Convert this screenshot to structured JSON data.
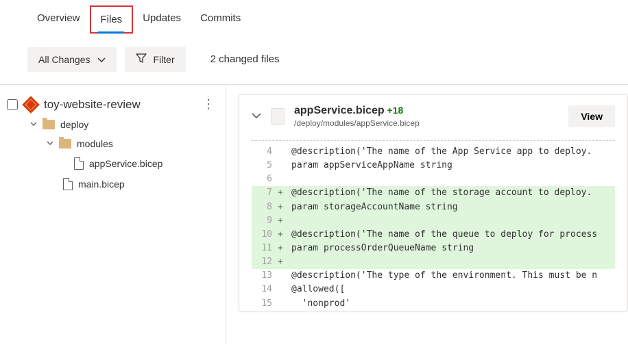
{
  "tabs": {
    "overview": "Overview",
    "files": "Files",
    "updates": "Updates",
    "commits": "Commits"
  },
  "toolbar": {
    "allChanges": "All Changes",
    "filter": "Filter",
    "summary": "2 changed files"
  },
  "tree": {
    "repo": "toy-website-review",
    "deploy": "deploy",
    "modules": "modules",
    "appService": "appService.bicep",
    "main": "main.bicep"
  },
  "diff": {
    "fileTitle": "appService.bicep",
    "plus": "+18",
    "filePath": "/deploy/modules/appService.bicep",
    "viewLabel": "View",
    "lines": [
      {
        "num": "4",
        "mark": " ",
        "add": false,
        "text": "@description('The name of the App Service app to deploy."
      },
      {
        "num": "5",
        "mark": " ",
        "add": false,
        "text": "param appServiceAppName string"
      },
      {
        "num": "6",
        "mark": " ",
        "add": false,
        "text": ""
      },
      {
        "num": "7",
        "mark": "+",
        "add": true,
        "text": "@description('The name of the storage account to deploy."
      },
      {
        "num": "8",
        "mark": "+",
        "add": true,
        "text": "param storageAccountName string"
      },
      {
        "num": "9",
        "mark": "+",
        "add": true,
        "text": ""
      },
      {
        "num": "10",
        "mark": "+",
        "add": true,
        "text": "@description('The name of the queue to deploy for process"
      },
      {
        "num": "11",
        "mark": "+",
        "add": true,
        "text": "param processOrderQueueName string"
      },
      {
        "num": "12",
        "mark": "+",
        "add": true,
        "text": ""
      },
      {
        "num": "13",
        "mark": " ",
        "add": false,
        "text": "@description('The type of the environment. This must be n"
      },
      {
        "num": "14",
        "mark": " ",
        "add": false,
        "text": "@allowed(["
      },
      {
        "num": "15",
        "mark": " ",
        "add": false,
        "text": "  'nonprod'"
      }
    ]
  }
}
